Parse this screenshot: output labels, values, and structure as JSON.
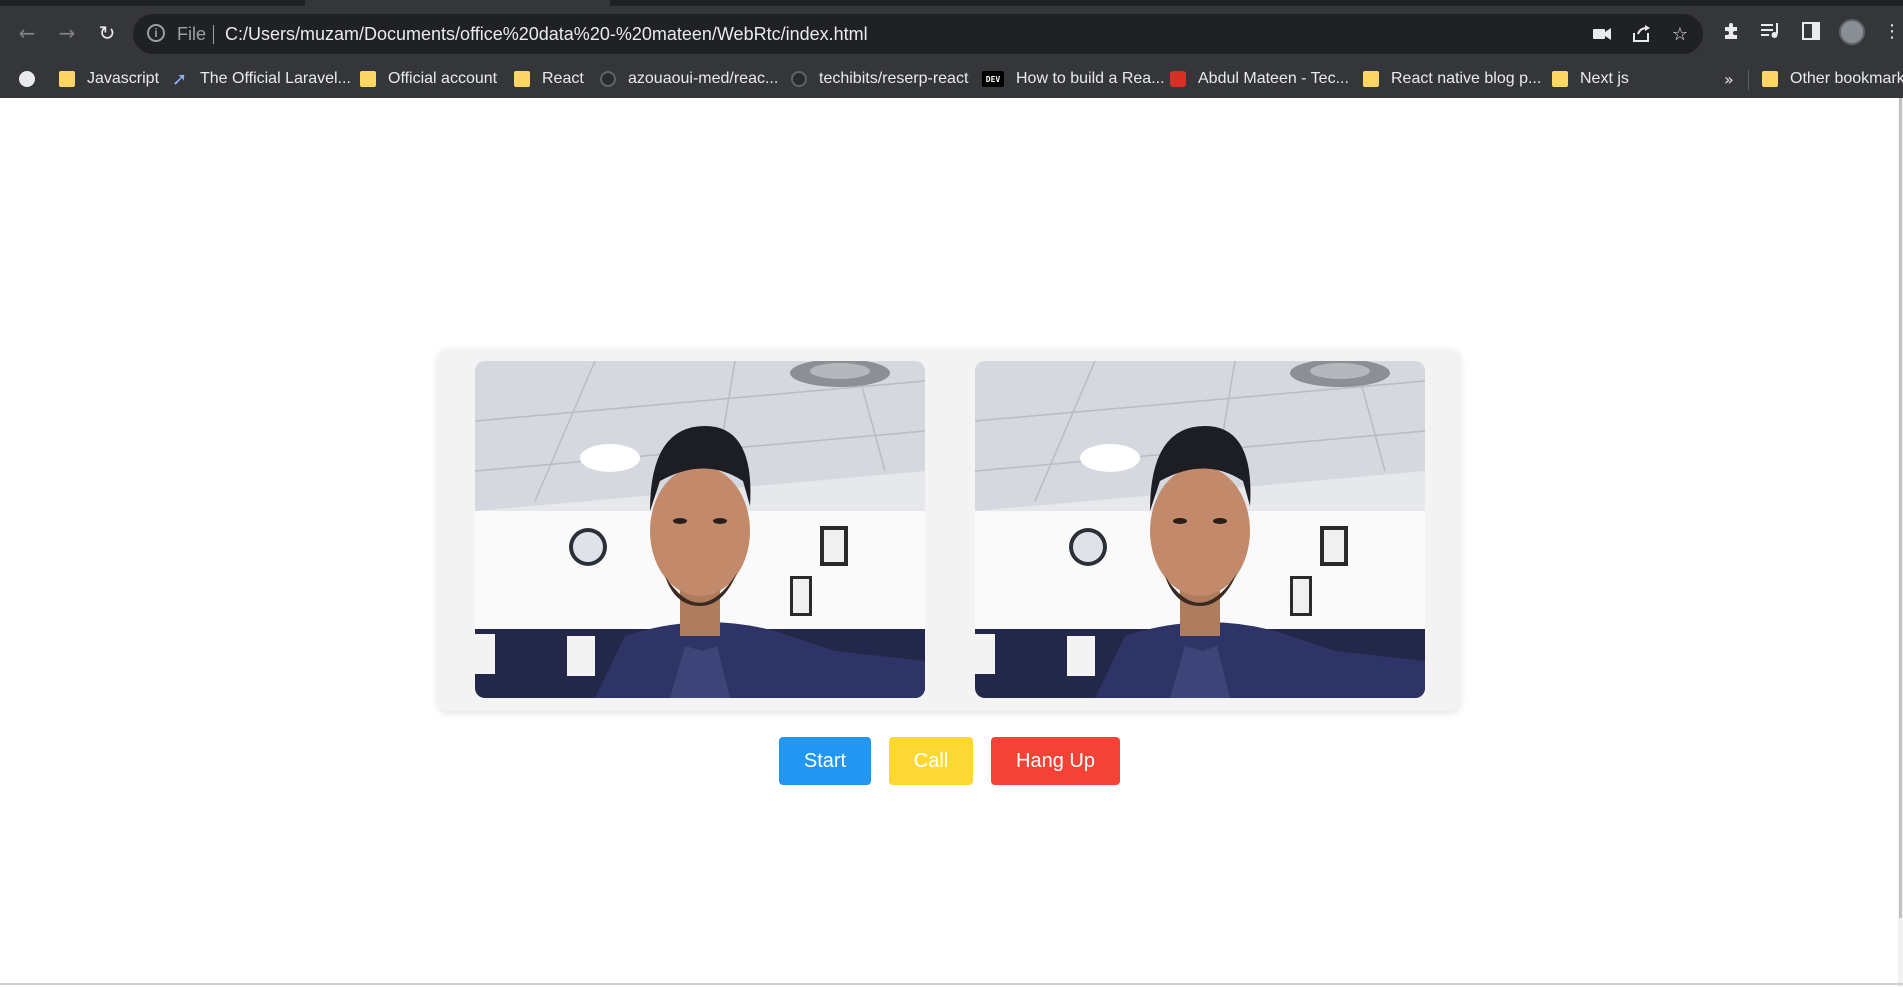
{
  "browser": {
    "file_label": "File",
    "url": "C:/Users/muzam/Documents/office%20data%20-%20mateen/WebRtc/index.html"
  },
  "bookmarks": [
    {
      "label": "Javascript",
      "icon": "folder-icon"
    },
    {
      "label": "The Official Laravel...",
      "icon": "rocket-icon"
    },
    {
      "label": "Official account",
      "icon": "folder-icon"
    },
    {
      "label": "React",
      "icon": "folder-icon"
    },
    {
      "label": "azouaoui-med/reac...",
      "icon": "github-icon"
    },
    {
      "label": "techibits/reserp-react",
      "icon": "github-icon"
    },
    {
      "label": "How to build a Rea...",
      "icon": "dev-icon",
      "icon_text": "DEV"
    },
    {
      "label": "Abdul Mateen - Tec...",
      "icon": "rocket-icon"
    },
    {
      "label": "React native blog p...",
      "icon": "folder-icon"
    },
    {
      "label": "Next js",
      "icon": "folder-icon"
    }
  ],
  "overflow_chevron": "»",
  "other_bookmarks": "Other bookmarks",
  "controls": {
    "start_label": "Start",
    "call_label": "Call",
    "hangup_label": "Hang Up"
  },
  "colors": {
    "start": "#2196f3",
    "call": "#fdd835",
    "hangup": "#f44336",
    "folder": "#fdd663",
    "chrome_bg": "#35363a"
  }
}
